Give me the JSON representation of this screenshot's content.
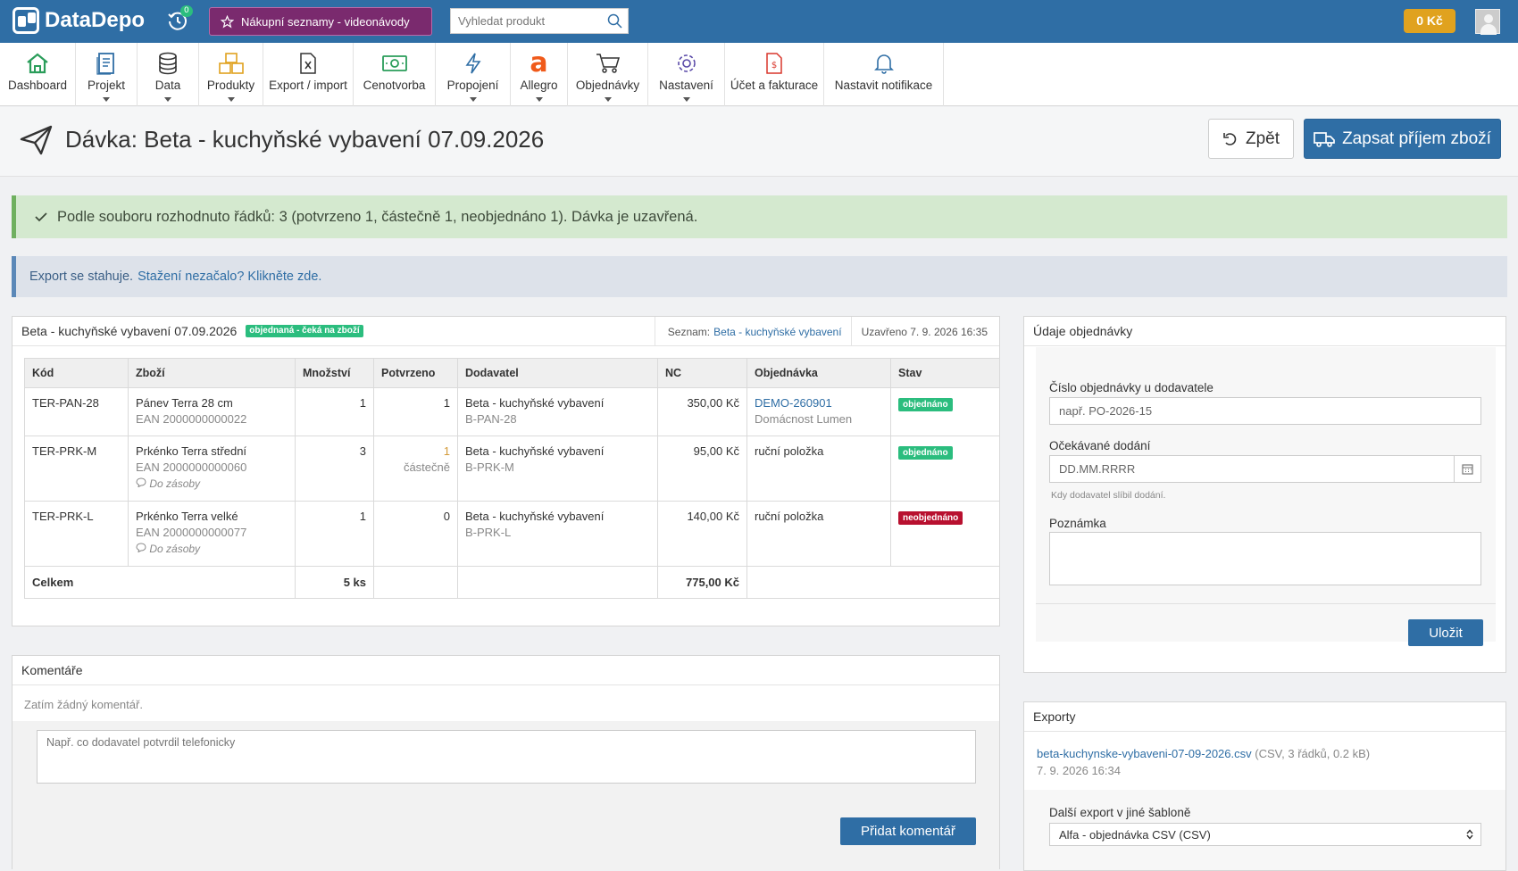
{
  "topbar": {
    "logo": "DataDepo",
    "history_badge": "0",
    "promo_label": "Nákupní seznamy - videonávody",
    "search_placeholder": "Vyhledat produkt",
    "credit": "0 Kč",
    "colors": {
      "bar": "#2f6ea5",
      "promo": "#7a2a6e",
      "credit": "#e0a21f"
    }
  },
  "nav": [
    {
      "label": "Dashboard",
      "icon": "home-icon"
    },
    {
      "label": "Projekt",
      "icon": "document-icon"
    },
    {
      "label": "Data",
      "icon": "database-icon"
    },
    {
      "label": "Produkty",
      "icon": "boxes-icon"
    },
    {
      "label": "Export / import",
      "icon": "file-excel-icon"
    },
    {
      "label": "Cenotvorba",
      "icon": "money-icon"
    },
    {
      "label": "Propojení",
      "icon": "lightning-icon"
    },
    {
      "label": "Allegro",
      "icon": "allegro-icon"
    },
    {
      "label": "Objednávky",
      "icon": "cart-icon"
    },
    {
      "label": "Nastavení",
      "icon": "gear-icon"
    },
    {
      "label": "Účet a fakturace",
      "icon": "invoice-icon"
    },
    {
      "label": "Nastavit notifikace",
      "icon": "bell-icon"
    }
  ],
  "page": {
    "title": "Dávka: Beta - kuchyňské vybavení 07.09.2026",
    "back_label": "Zpět",
    "receive_label": "Zapsat příjem zboží"
  },
  "alerts": {
    "success": "Podle souboru rozhodnuto řádků: 3 (potvrzeno 1, částečně 1, neobjednáno 1). Dávka je uzavřená.",
    "info_text": "Export se stahuje.",
    "info_link": "Stažení nezačalo? Klikněte zde."
  },
  "batch": {
    "name": "Beta - kuchyňské vybavení 07.09.2026",
    "status_label": "objednaná - čeká na zboží",
    "list_prefix": "Seznam:",
    "list_link": "Beta - kuchyňské vybavení",
    "closed": "Uzavřeno 7. 9. 2026 16:35",
    "columns": [
      "Kód",
      "Zboží",
      "Množství",
      "Potvrzeno",
      "Dodavatel",
      "NC",
      "Objednávka",
      "Stav"
    ],
    "rows": [
      {
        "code": "TER-PAN-28",
        "name": "Pánev Terra 28 cm",
        "ean": "EAN 2000000000022",
        "note": "",
        "qty": "1",
        "confirmed": "1",
        "confirmed_sub": "",
        "supplier": "Beta - kuchyňské vybavení",
        "supplier_code": "B-PAN-28",
        "price": "350,00 Kč",
        "order": "DEMO-260901",
        "order_sub": "Domácnost Lumen",
        "order_is_link": true,
        "status": "objednáno"
      },
      {
        "code": "TER-PRK-M",
        "name": "Prkénko Terra střední",
        "ean": "EAN 2000000000060",
        "note": "Do zásoby",
        "qty": "3",
        "confirmed": "1",
        "confirmed_sub": "částečně",
        "supplier": "Beta - kuchyňské vybavení",
        "supplier_code": "B-PRK-M",
        "price": "95,00 Kč",
        "order": "ruční položka",
        "order_sub": "",
        "order_is_link": false,
        "status": "objednáno"
      },
      {
        "code": "TER-PRK-L",
        "name": "Prkénko Terra velké",
        "ean": "EAN 2000000000077",
        "note": "Do zásoby",
        "qty": "1",
        "confirmed": "0",
        "confirmed_sub": "",
        "supplier": "Beta - kuchyňské vybavení",
        "supplier_code": "B-PRK-L",
        "price": "140,00 Kč",
        "order": "ruční položka",
        "order_sub": "",
        "order_is_link": false,
        "status": "neobjednáno"
      }
    ],
    "total_label": "Celkem",
    "total_qty": "5 ks",
    "total_price": "775,00 Kč"
  },
  "comments": {
    "title": "Komentáře",
    "empty": "Zatím žádný komentář.",
    "placeholder": "Např. co dodavatel potvrdil telefonicky",
    "add_label": "Přidat komentář"
  },
  "order_info": {
    "title": "Údaje objednávky",
    "order_no_label": "Číslo objednávky u dodavatele",
    "order_no_placeholder": "např. PO-2026-15",
    "delivery_label": "Očekávané dodání",
    "delivery_placeholder": "DD.MM.RRRR",
    "delivery_hint": "Kdy dodavatel slíbil dodání.",
    "note_label": "Poznámka",
    "save_label": "Uložit"
  },
  "exports": {
    "title": "Exporty",
    "file_link": "beta-kuchynske-vybaveni-07-09-2026.csv",
    "file_meta": "(CSV, 3 řádků, 0.2 kB)",
    "file_date": "7. 9. 2026 16:34",
    "other_label": "Další export v jiné šabloně",
    "template_selected": "Alfa - objednávka CSV (CSV)"
  }
}
